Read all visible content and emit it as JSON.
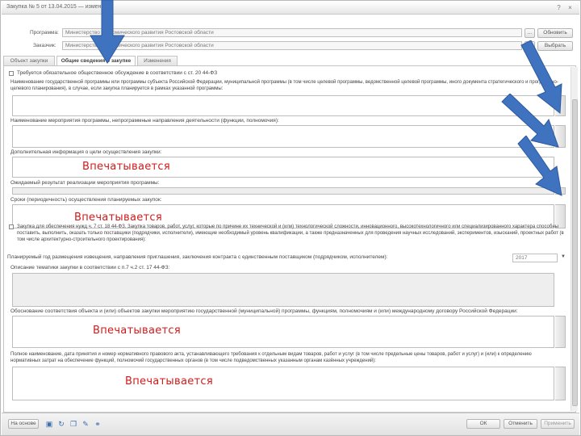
{
  "window": {
    "title": "Закупка № 5 от 13.04.2015 — изменения",
    "help_glyph": "?",
    "close_glyph": "×"
  },
  "header": {
    "program_label": "Программа:",
    "program_value": "Министерство экономического развития Ростовской области",
    "program_browse": "...",
    "program_button": "Обновить",
    "customer_label": "Заказчик:",
    "customer_value": "Министерство экономического развития Ростовской области",
    "customer_browse": "...",
    "customer_button": "Выбрать"
  },
  "tabs": [
    {
      "label": "Объект закупки"
    },
    {
      "label": "Общие сведения о закупке"
    },
    {
      "label": "Изменения"
    }
  ],
  "form": {
    "q1": "Требуется обязательное общественное обсуждение в соответствии с ст. 20 44-ФЗ",
    "q2": "Наименование государственной программы или программы субъекта Российской Федерации, муниципальной программы (в том числе целевой программы, ведомственной целевой программы, иного документа стратегического и программно-целевого планирования), в случае, если закупка планируется в рамках указанной программы:",
    "q3": "Наименование мероприятия программы, непрограммные направления деятельности (функции, полномочия):",
    "q4": "Дополнительная информация о цели осуществления закупки:",
    "q5": "Ожидаемый результат реализации мероприятия программы:",
    "q6": "Сроки (периодичность) осуществления планируемых закупок:",
    "q7": "Закупка для обеспечения нужд ч. 7 ст. 18 44-ФЗ. Закупка товаров, работ, услуг, которые по причине их технической и (или) технологической сложности, инновационного, высокотехнологичного или специализированного характера способны поставить, выполнить, оказать только поставщики (подрядчики, исполнители), имеющие необходимый уровень квалификации, а также предназначенных для проведения научных исследований, экспериментов, изысканий, проектных работ (в том числе архитектурно-строительного проектирования):",
    "q8": "Планируемый год размещения извещения, направления приглашения, заключения контракта с единственным поставщиком (подрядчиком, исполнителем):",
    "year_value": "2017",
    "q9": "Описание тематики закупки в соответствии с п.7 ч.2 ст. 17 44-ФЗ:",
    "q10": "Обоснование соответствия объекта и (или) объектов закупки мероприятию государственной (муниципальной) программы, функциям, полномочиям и (или) международному договору Российской Федерации:",
    "q11": "Полное наименование, дата принятия и номер нормативного правового акта, устанавливающего требования к отдельным видам товаров, работ и услуг (в том числе предельные цены товаров, работ и услуг) и (или) к определению нормативных затрат на обеспечение функций, полномочий государственных органов (в том числе подведомственных указанным органам казённых учреждений):",
    "annotation": "Впечатывается"
  },
  "footer": {
    "select_value": "На основе",
    "ok": "ОК",
    "cancel": "Отменить",
    "apply": "Применить"
  },
  "icons": [
    "save-icon",
    "refresh-icon",
    "copy-icon",
    "attach-icon",
    "link-icon"
  ],
  "colors": {
    "arrow": "#3f73c0",
    "annotation": "#d11a1a"
  }
}
